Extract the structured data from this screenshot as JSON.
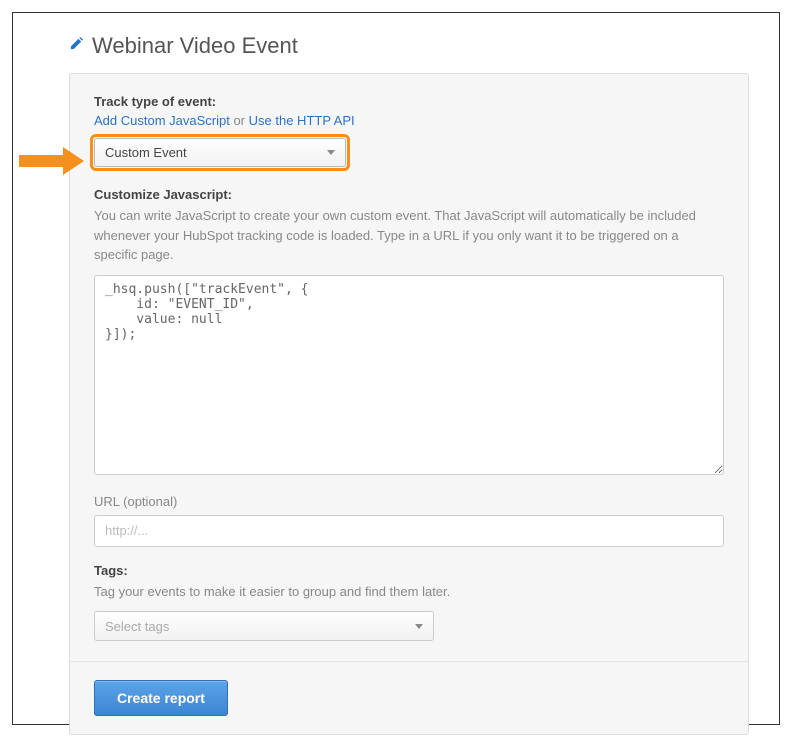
{
  "header": {
    "title": "Webinar Video Event"
  },
  "track": {
    "label": "Track type of event:",
    "link_js": "Add Custom JavaScript",
    "link_sep": " or ",
    "link_api": "Use the HTTP API",
    "selected": "Custom Event"
  },
  "customize": {
    "label": "Customize Javascript:",
    "help": "You can write JavaScript to create your own custom event. That JavaScript will automatically be included whenever your HubSpot tracking code is loaded. Type in a URL if you only want it to be triggered on a specific page.",
    "code": "_hsq.push([\"trackEvent\", {\n    id: \"EVENT_ID\",\n    value: null\n}]);"
  },
  "url": {
    "label": "URL (optional)",
    "placeholder": "http://..."
  },
  "tags": {
    "label": "Tags:",
    "help": "Tag your events to make it easier to group and find them later.",
    "placeholder": "Select tags"
  },
  "footer": {
    "create_label": "Create report"
  }
}
